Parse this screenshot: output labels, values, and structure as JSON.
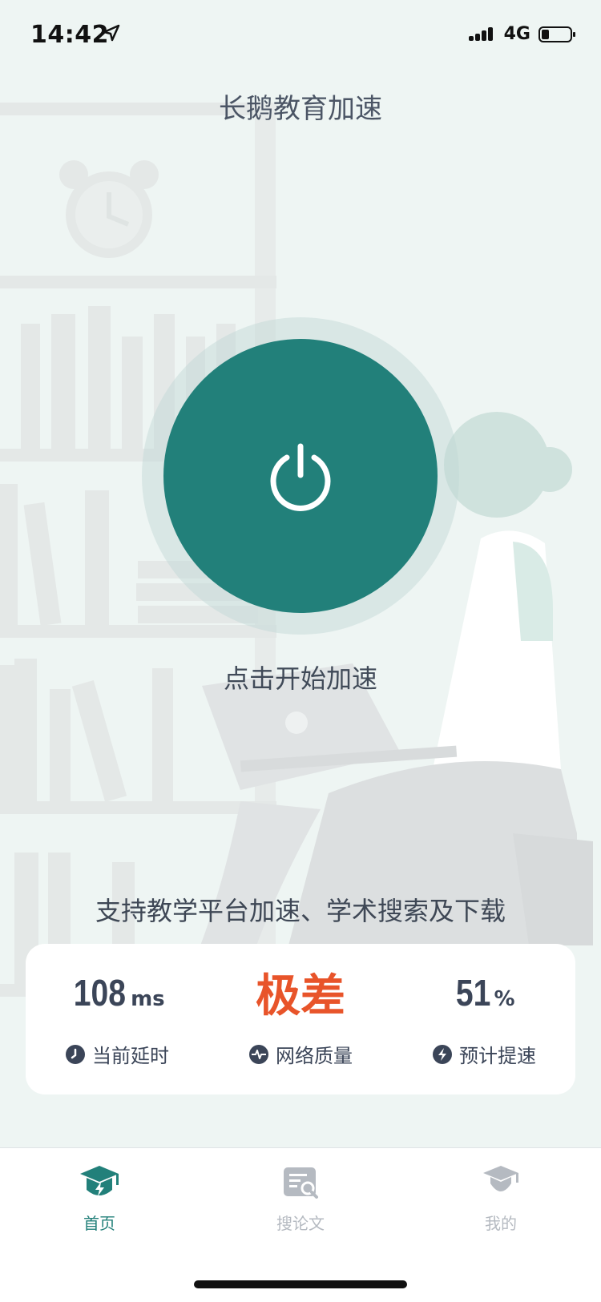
{
  "status_bar": {
    "time": "14:42",
    "network": "4G"
  },
  "header": {
    "title": "长鹅教育加速"
  },
  "main": {
    "start_label": "点击开始加速",
    "support_text": "支持教学平台加速、学术搜索及下载"
  },
  "stats": {
    "latency": {
      "value": "108",
      "unit": "ms",
      "label": "当前延时"
    },
    "quality": {
      "value": "极差",
      "label": "网络质量"
    },
    "speedup": {
      "value": "51",
      "unit": "%",
      "label": "预计提速"
    }
  },
  "tabbar": {
    "tabs": [
      {
        "label": "首页",
        "icon": "graduation-cap-bolt-icon",
        "active": true
      },
      {
        "label": "搜论文",
        "icon": "paper-search-icon",
        "active": false
      },
      {
        "label": "我的",
        "icon": "graduate-avatar-icon",
        "active": false
      }
    ]
  },
  "colors": {
    "accent": "#22807a",
    "bad": "#e8542a",
    "text": "#3b4558",
    "inactive": "#b5bac1"
  }
}
